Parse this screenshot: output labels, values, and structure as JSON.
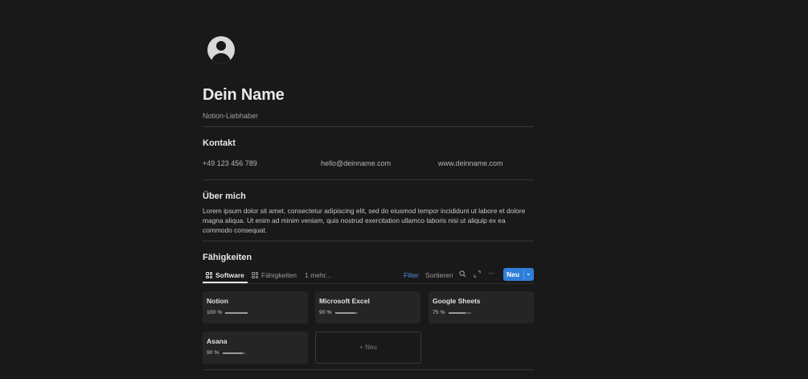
{
  "profile": {
    "name": "Dein Name",
    "subtitle": "Notion-Liebhaber"
  },
  "contact": {
    "heading": "Kontakt",
    "phone": "+49 123 456 789",
    "email": "hello@deinname.com",
    "website": "www.deinname.com"
  },
  "about": {
    "heading": "Über mich",
    "text": "Lorem ipsum dolor sit amet, consectetur adipiscing elit, sed do eiusmod tempor incididunt ut labore et dolore magna aliqua. Ut enim ad minim veniam, quis nostrud exercitation ullamco laboris nisi ut aliquip ex ea commodo consequat."
  },
  "skills": {
    "heading": "Fähigkeiten",
    "tabs": [
      {
        "label": "Software",
        "icon": "grid-icon"
      },
      {
        "label": "Fähigkeiten",
        "icon": "grid-icon"
      },
      {
        "label": "1 mehr..."
      }
    ],
    "toolbar": {
      "filter": "Filter",
      "sort": "Sortieren",
      "search_icon": "search-icon",
      "expand_icon": "expand-icon",
      "more_icon": "more-icon",
      "new_label": "Neu"
    },
    "cards": [
      {
        "title": "Notion",
        "percent_label": "100 %",
        "progress": 1.0
      },
      {
        "title": "Microsoft Excel",
        "percent_label": "90 %",
        "progress": 0.9
      },
      {
        "title": "Google Sheets",
        "percent_label": "75 %",
        "progress": 0.75
      },
      {
        "title": "Asana",
        "percent_label": "90 %",
        "progress": 0.9
      }
    ],
    "new_card_label": "+ Neu"
  },
  "colors": {
    "background": "#191919",
    "accent": "#2f7ed8",
    "filter_text": "#4f8fe0"
  }
}
